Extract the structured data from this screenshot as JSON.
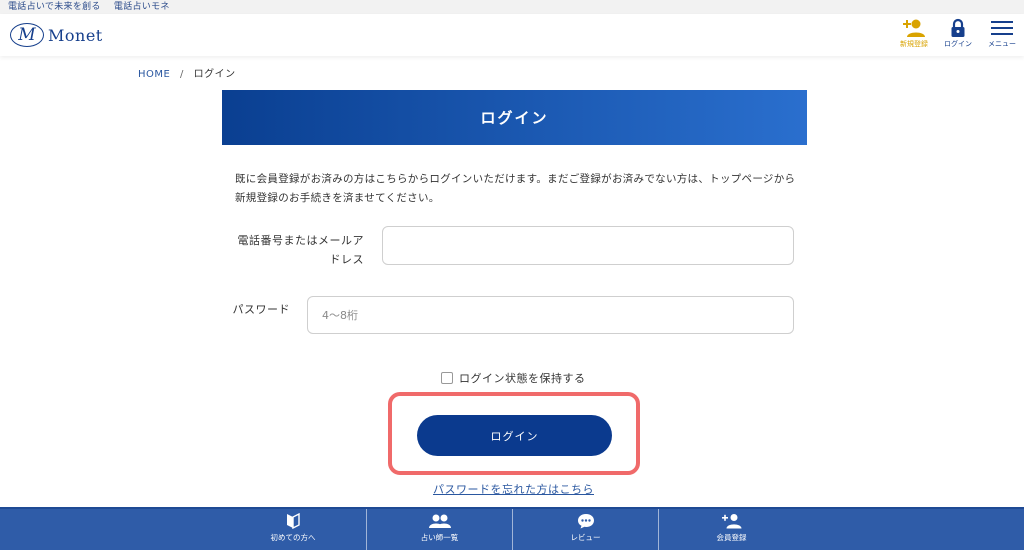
{
  "topstrip": {
    "links": [
      "電話占いで未来を創る",
      "電話占いモネ"
    ]
  },
  "header": {
    "logo_mark": "M",
    "logo_text": "Monet",
    "register_label": "新規登録",
    "login_label": "ログイン",
    "menu_label": "メニュー"
  },
  "breadcrumb": {
    "home": "HOME",
    "separator": "/",
    "current": "ログイン"
  },
  "page": {
    "title": "ログイン",
    "intro": "既に会員登録がお済みの方はこちらからログインいただけます。まだご登録がお済みでない方は、トップページから新規登録のお手続きを済ませてください。"
  },
  "form": {
    "tel_label": "電話番号またはメールアドレス",
    "tel_value": "",
    "tel_placeholder": "",
    "password_label": "パスワード",
    "password_value": "",
    "password_placeholder": "4～8桁",
    "remember_label": "ログイン状態を保持する",
    "submit_label": "ログイン",
    "forgot_label": "パスワードを忘れた方はこちら"
  },
  "bottom_nav": {
    "beginner": "初めての方へ",
    "fortune_tellers": "占い師一覧",
    "reviews": "レビュー",
    "register": "会員登録"
  },
  "colors": {
    "brand": "#0b3a8e",
    "accent_register": "#d9a300",
    "highlight": "#f06a6a",
    "bottom_nav": "#2f5ca8"
  }
}
